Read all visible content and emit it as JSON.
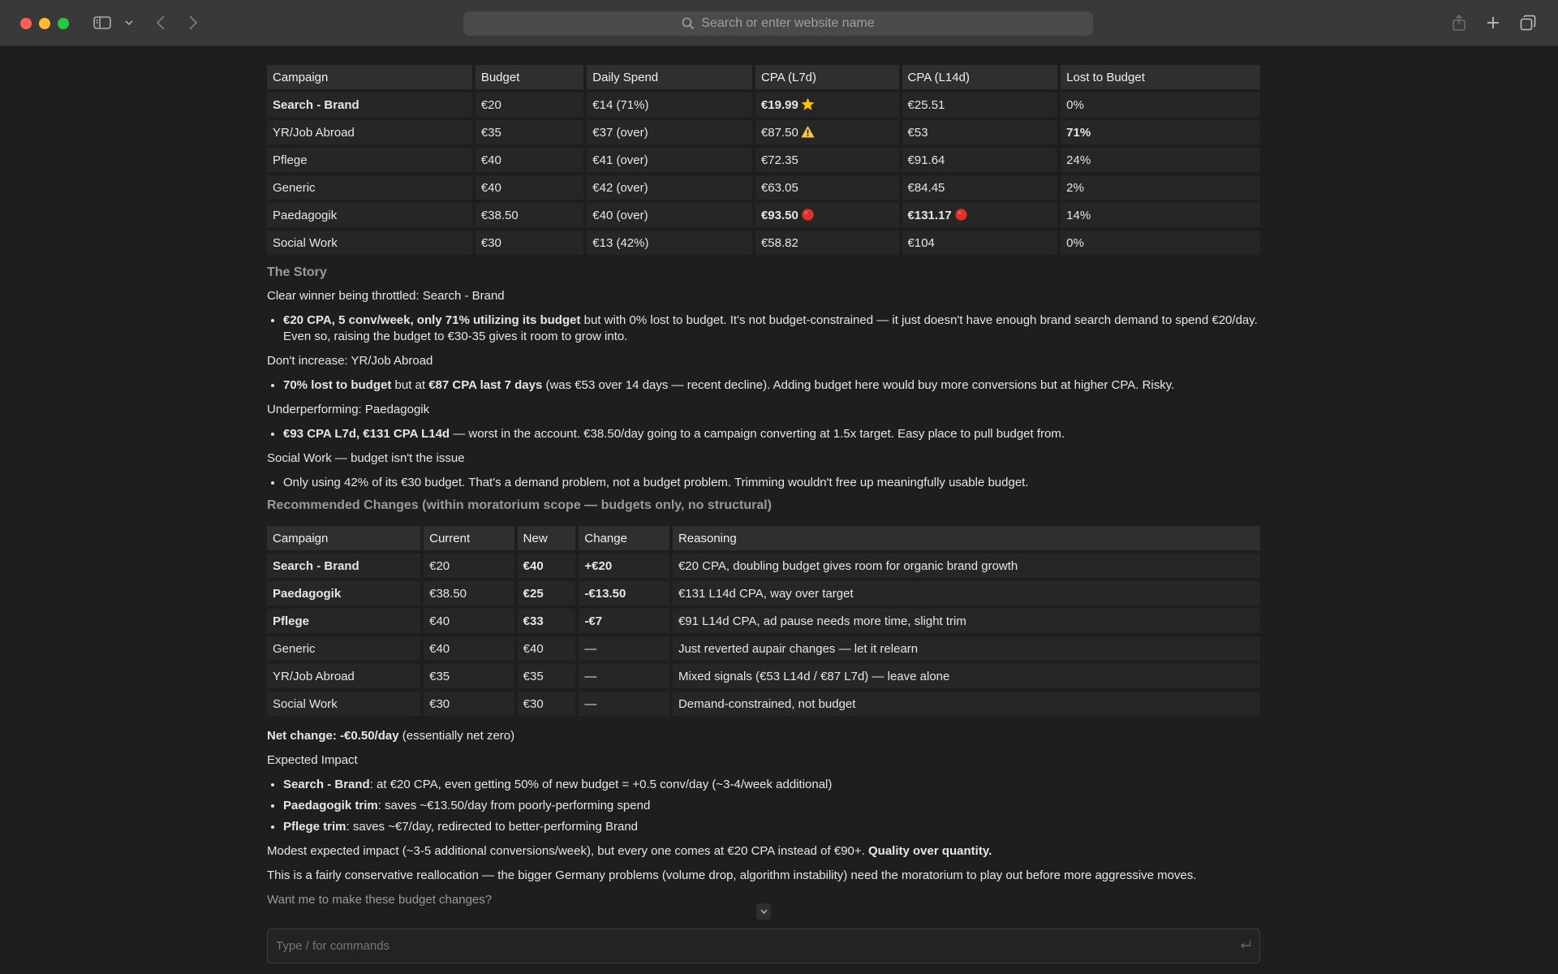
{
  "browser": {
    "address_placeholder": "Search or enter website name"
  },
  "table1": {
    "headers": [
      "Campaign",
      "Budget",
      "Daily Spend",
      "CPA (L7d)",
      "CPA (L14d)",
      "Lost to Budget"
    ],
    "rows": [
      [
        "Search - Brand",
        "€20",
        "€14 (71%)",
        "€19.99",
        "€25.51",
        "0%"
      ],
      [
        "YR/Job Abroad",
        "€35",
        "€37 (over)",
        "€87.50",
        "€53",
        "71%"
      ],
      [
        "Pflege",
        "€40",
        "€41 (over)",
        "€72.35",
        "€91.64",
        "24%"
      ],
      [
        "Generic",
        "€40",
        "€42 (over)",
        "€63.05",
        "€84.45",
        "2%"
      ],
      [
        "Paedagogik",
        "€38.50",
        "€40 (over)",
        "€93.50",
        "€131.17",
        "14%"
      ],
      [
        "Social Work",
        "€30",
        "€13 (42%)",
        "€58.82",
        "€104",
        "0%"
      ]
    ]
  },
  "story": {
    "heading": "The Story",
    "s1_title": "Clear winner being throttled: Search - Brand",
    "s1_bold": "€20 CPA, 5 conv/week, only 71% utilizing its budget",
    "s1_rest": " but with 0% lost to budget. It's not budget-constrained — it just doesn't have enough brand search demand to spend €20/day. Even so, raising the budget to €30-35 gives it room to grow into.",
    "s2_title": "Don't increase: YR/Job Abroad",
    "s2_bold1": "70% lost to budget",
    "s2_mid": " but at ",
    "s2_bold2": "€87 CPA last 7 days",
    "s2_rest": " (was €53 over 14 days — recent decline). Adding budget here would buy more conversions but at higher CPA. Risky.",
    "s3_title": "Underperforming: Paedagogik",
    "s3_bold": "€93 CPA L7d, €131 CPA L14d",
    "s3_rest": " — worst in the account. €38.50/day going to a campaign converting at 1.5x target. Easy place to pull budget from.",
    "s4_title": "Social Work — budget isn't the issue",
    "s4_text": "Only using 42% of its €30 budget. That's a demand problem, not a budget problem. Trimming wouldn't free up meaningfully usable budget."
  },
  "recommended": {
    "heading": "Recommended Changes (within moratorium scope — budgets only, no structural)",
    "headers": [
      "Campaign",
      "Current",
      "New",
      "Change",
      "Reasoning"
    ],
    "rows": [
      [
        "Search - Brand",
        "€20",
        "€40",
        "+€20",
        "€20 CPA, doubling budget gives room for organic brand growth"
      ],
      [
        "Paedagogik",
        "€38.50",
        "€25",
        "-€13.50",
        "€131 L14d CPA, way over target"
      ],
      [
        "Pflege",
        "€40",
        "€33",
        "-€7",
        "€91 L14d CPA, ad pause needs more time, slight trim"
      ],
      [
        "Generic",
        "€40",
        "€40",
        "—",
        "Just reverted aupair changes — let it relearn"
      ],
      [
        "YR/Job Abroad",
        "€35",
        "€35",
        "—",
        "Mixed signals (€53 L14d / €87 L7d) — leave alone"
      ],
      [
        "Social Work",
        "€30",
        "€30",
        "—",
        "Demand-constrained, not budget"
      ]
    ]
  },
  "net_change": {
    "bold": "Net change: -€0.50/day",
    "rest": " (essentially net zero)"
  },
  "impact": {
    "heading": "Expected Impact",
    "i1_bold": "Search - Brand",
    "i1_rest": ": at €20 CPA, even getting 50% of new budget = +0.5 conv/day (~3-4/week additional)",
    "i2_bold": "Paedagogik trim",
    "i2_rest": ": saves ~€13.50/day from poorly-performing spend",
    "i3_bold": "Pflege trim",
    "i3_rest": ": saves ~€7/day, redirected to better-performing Brand"
  },
  "closing": {
    "p1_text": "Modest expected impact (~3-5 additional conversions/week), but every one comes at €20 CPA instead of €90+. ",
    "p1_bold": "Quality over quantity.",
    "p2": "This is a fairly conservative reallocation — the bigger Germany problems (volume drop, algorithm instability) need the moratorium to play out before more aggressive moves.",
    "question": "Want me to make these budget changes?"
  },
  "composer": {
    "placeholder": "Type / for commands"
  },
  "colors": {
    "background": "#1e1e1e",
    "table_header": "#2f2f2f",
    "table_cell": "#262626",
    "star": "#f5c518",
    "warning": "#f2c94c",
    "red_circle": "#e0312b"
  }
}
